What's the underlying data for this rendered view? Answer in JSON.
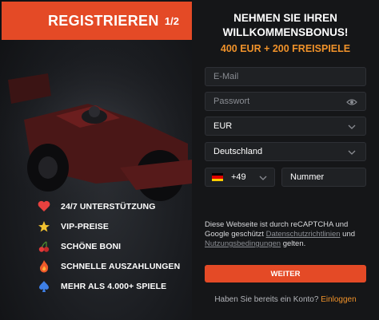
{
  "header": {
    "title": "REGISTRIEREN",
    "step": "1/2"
  },
  "benefits": [
    {
      "icon": "heart-icon",
      "label": "24/7 UNTERSTÜTZUNG"
    },
    {
      "icon": "star-icon",
      "label": "VIP-PREISE"
    },
    {
      "icon": "cherries-icon",
      "label": "SCHÖNE BONI"
    },
    {
      "icon": "fire-icon",
      "label": "SCHNELLE AUSZAHLUNGEN"
    },
    {
      "icon": "spade-icon",
      "label": "MEHR ALS 4.000+ SPIELE"
    }
  ],
  "bonus": {
    "title_line1": "NEHMEN SIE IHREN",
    "title_line2": "WILLKOMMENSBONUS!",
    "offer": "400 EUR + 200 FREISPIELE"
  },
  "form": {
    "email_placeholder": "E-Mail",
    "password_placeholder": "Passwort",
    "currency": "EUR",
    "country": "Deutschland",
    "phone_code": "+49",
    "phone_placeholder": "Nummer"
  },
  "captcha": {
    "text1": "Diese Webseite ist durch reCAPTCHA und",
    "text2": "Google geschützt",
    "link1": "Datenschutzrichtlinien",
    "text3": "und",
    "link2": "Nutzungsbedingungen",
    "text4": "gelten."
  },
  "submit_label": "WEITER",
  "login": {
    "question": "Haben Sie bereits ein Konto?",
    "link": "Einloggen"
  },
  "colors": {
    "accent": "#e44a26",
    "highlight": "#f0922a",
    "panel": "#151618"
  }
}
